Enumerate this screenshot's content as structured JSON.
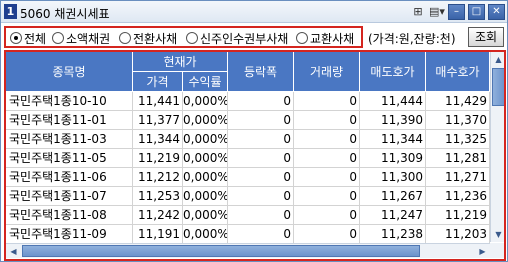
{
  "window": {
    "title": "5060 채권시세표",
    "badges": [
      "1",
      "2"
    ],
    "icons": [
      "pin-icon",
      "menu-icon"
    ],
    "controls": [
      "minimize-icon",
      "restore-icon",
      "close-icon"
    ],
    "control_glyphs": {
      "minimize": "–",
      "restore": "□",
      "close": "✕"
    }
  },
  "filters": {
    "options": [
      {
        "label": "전체",
        "selected": true
      },
      {
        "label": "소액채권",
        "selected": false
      },
      {
        "label": "전환사채",
        "selected": false
      },
      {
        "label": "신주인수권부사채",
        "selected": false
      },
      {
        "label": "교환사채",
        "selected": false
      }
    ],
    "unit_text": "(가격:원,잔량:천)",
    "search_label": "조회"
  },
  "table": {
    "headers": {
      "name": "종목명",
      "current": "현재가",
      "price": "가격",
      "yield": "수익률",
      "change": "등락폭",
      "volume": "거래량",
      "ask": "매도호가",
      "bid": "매수호가"
    },
    "rows": [
      {
        "name": "국민주택1종10-10",
        "price": "11,441",
        "yield": "0,000%",
        "change": "0",
        "volume": "0",
        "ask": "11,444",
        "bid": "11,429"
      },
      {
        "name": "국민주택1종11-01",
        "price": "11,377",
        "yield": "0,000%",
        "change": "0",
        "volume": "0",
        "ask": "11,390",
        "bid": "11,370"
      },
      {
        "name": "국민주택1종11-03",
        "price": "11,344",
        "yield": "0,000%",
        "change": "0",
        "volume": "0",
        "ask": "11,344",
        "bid": "11,325"
      },
      {
        "name": "국민주택1종11-05",
        "price": "11,219",
        "yield": "0,000%",
        "change": "0",
        "volume": "0",
        "ask": "11,309",
        "bid": "11,281"
      },
      {
        "name": "국민주택1종11-06",
        "price": "11,212",
        "yield": "0,000%",
        "change": "0",
        "volume": "0",
        "ask": "11,300",
        "bid": "11,271"
      },
      {
        "name": "국민주택1종11-07",
        "price": "11,253",
        "yield": "0,000%",
        "change": "0",
        "volume": "0",
        "ask": "11,267",
        "bid": "11,236"
      },
      {
        "name": "국민주택1종11-08",
        "price": "11,242",
        "yield": "0,000%",
        "change": "0",
        "volume": "0",
        "ask": "11,247",
        "bid": "11,219"
      },
      {
        "name": "국민주택1종11-09",
        "price": "11,191",
        "yield": "0,000%",
        "change": "0",
        "volume": "0",
        "ask": "11,238",
        "bid": "11,203"
      }
    ]
  },
  "colors": {
    "header_bg": "#4a77c3",
    "highlight_border": "#d4251f",
    "badge_bg": "#1f3f8f"
  }
}
